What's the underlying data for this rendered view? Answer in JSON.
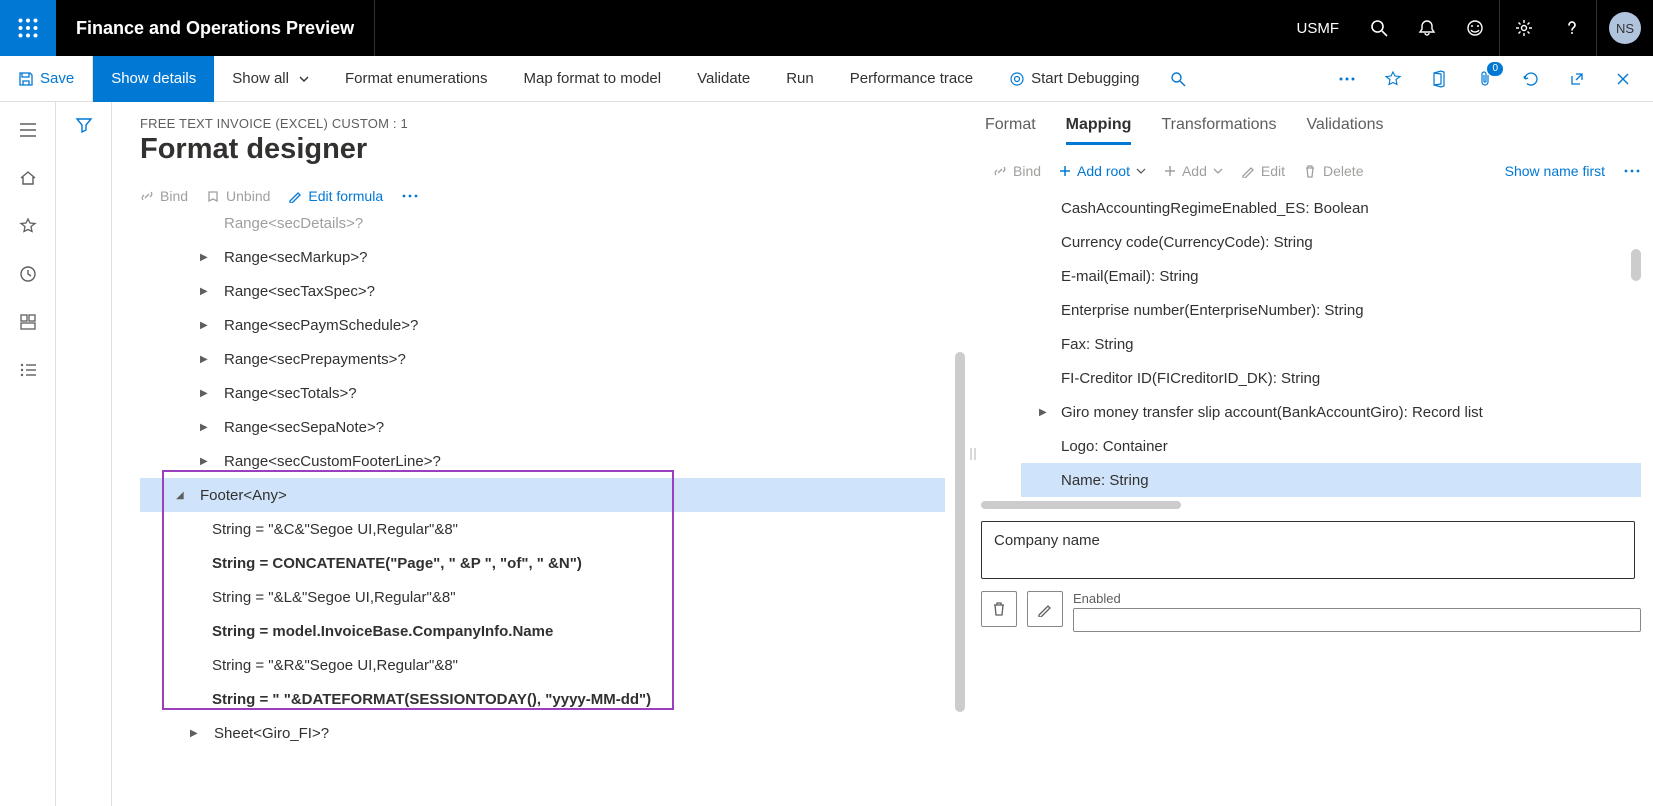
{
  "topbar": {
    "app_title": "Finance and Operations Preview",
    "entity": "USMF",
    "avatar": "NS"
  },
  "cmdbar": {
    "save": "Save",
    "show_details": "Show details",
    "show_all": "Show all",
    "format_enum": "Format enumerations",
    "map_to_model": "Map format to model",
    "validate": "Validate",
    "run": "Run",
    "perf_trace": "Performance trace",
    "start_debug": "Start Debugging",
    "attach_badge": "0"
  },
  "page": {
    "breadcrumb": "FREE TEXT INVOICE (EXCEL) CUSTOM : 1",
    "title": "Format designer"
  },
  "format_toolbar": {
    "bind": "Bind",
    "unbind": "Unbind",
    "edit_formula": "Edit formula"
  },
  "tree": {
    "r0": "Range<secDetails>?",
    "r1": "Range<secMarkup>?",
    "r2": "Range<secTaxSpec>?",
    "r3": "Range<secPaymSchedule>?",
    "r4": "Range<secPrepayments>?",
    "r5": "Range<secTotals>?",
    "r6": "Range<secSepaNote>?",
    "r7": "Range<secCustomFooterLine>?",
    "footer": "Footer<Any>",
    "s1": "String = \"&C&\"Segoe UI,Regular\"&8\"",
    "s2": "String = CONCATENATE(\"Page\", \" &P \", \"of\", \" &N\")",
    "s3": "String = \"&L&\"Segoe UI,Regular\"&8\"",
    "s4": "String = model.InvoiceBase.CompanyInfo.Name",
    "s5": "String = \"&R&\"Segoe UI,Regular\"&8\"",
    "s6": "String = \" \"&DATEFORMAT(SESSIONTODAY(), \"yyyy-MM-dd\")",
    "giro": "Sheet<Giro_FI>?"
  },
  "tabs": {
    "format": "Format",
    "mapping": "Mapping",
    "transformations": "Transformations",
    "validations": "Validations"
  },
  "map_toolbar": {
    "bind": "Bind",
    "add_root": "Add root",
    "add": "Add",
    "edit": "Edit",
    "delete": "Delete",
    "show_name_first": "Show name first"
  },
  "map_list": {
    "i0": "CashAccountingRegimeEnabled_ES: Boolean",
    "i1": "Currency code(CurrencyCode): String",
    "i2": "E-mail(Email): String",
    "i3": "Enterprise number(EnterpriseNumber): String",
    "i4": "Fax: String",
    "i5": "FI-Creditor ID(FICreditorID_DK): String",
    "i6": "Giro money transfer slip account(BankAccountGiro): Record list",
    "i7": "Logo: Container",
    "i8": "Name: String"
  },
  "detail": {
    "field_value": "Company name",
    "enabled_label": "Enabled"
  }
}
